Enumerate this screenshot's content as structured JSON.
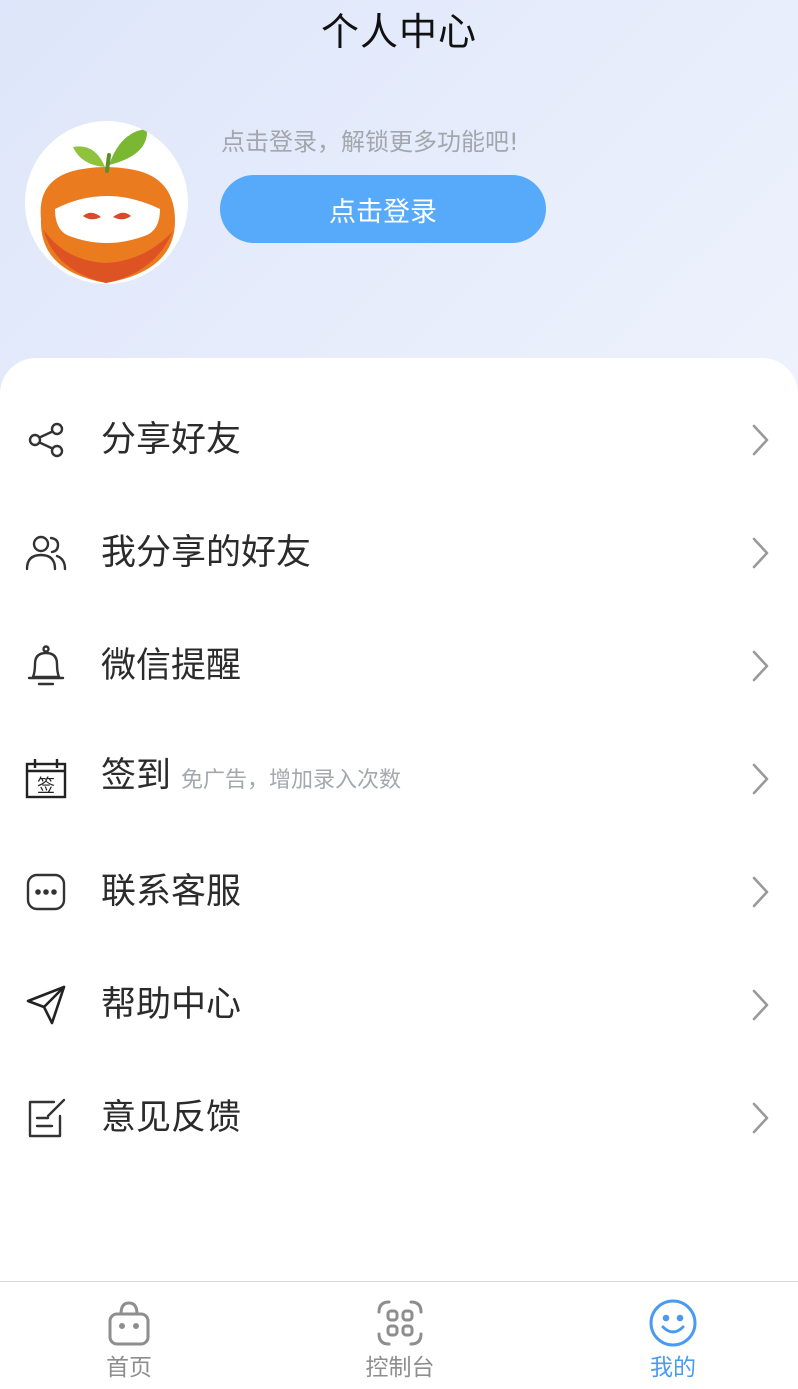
{
  "header": {
    "title": "个人中心"
  },
  "profile": {
    "login_hint": "点击登录，解锁更多功能吧!",
    "login_button": "点击登录",
    "avatar_icon": "tangerine-mascot-icon"
  },
  "menu": {
    "items": [
      {
        "label": "分享好友",
        "icon": "share-icon"
      },
      {
        "label": "我分享的好友",
        "icon": "users-icon"
      },
      {
        "label": "微信提醒",
        "icon": "bell-icon"
      },
      {
        "label": "签到",
        "sub": "免广告，增加录入次数",
        "icon": "sign-in-calendar-icon",
        "icon_char": "签"
      },
      {
        "label": "联系客服",
        "icon": "chat-bubble-icon"
      },
      {
        "label": "帮助中心",
        "icon": "paper-plane-icon"
      },
      {
        "label": "意见反馈",
        "icon": "edit-note-icon"
      }
    ]
  },
  "tabbar": {
    "tabs": [
      {
        "label": "首页",
        "icon": "shopping-bag-icon",
        "active": false
      },
      {
        "label": "控制台",
        "icon": "grid-icon",
        "active": false
      },
      {
        "label": "我的",
        "icon": "smile-icon",
        "active": true
      }
    ]
  },
  "colors": {
    "accent": "#57aaf9",
    "active_tab": "#4a9bf0",
    "inactive_tab": "#8e8e8e"
  }
}
